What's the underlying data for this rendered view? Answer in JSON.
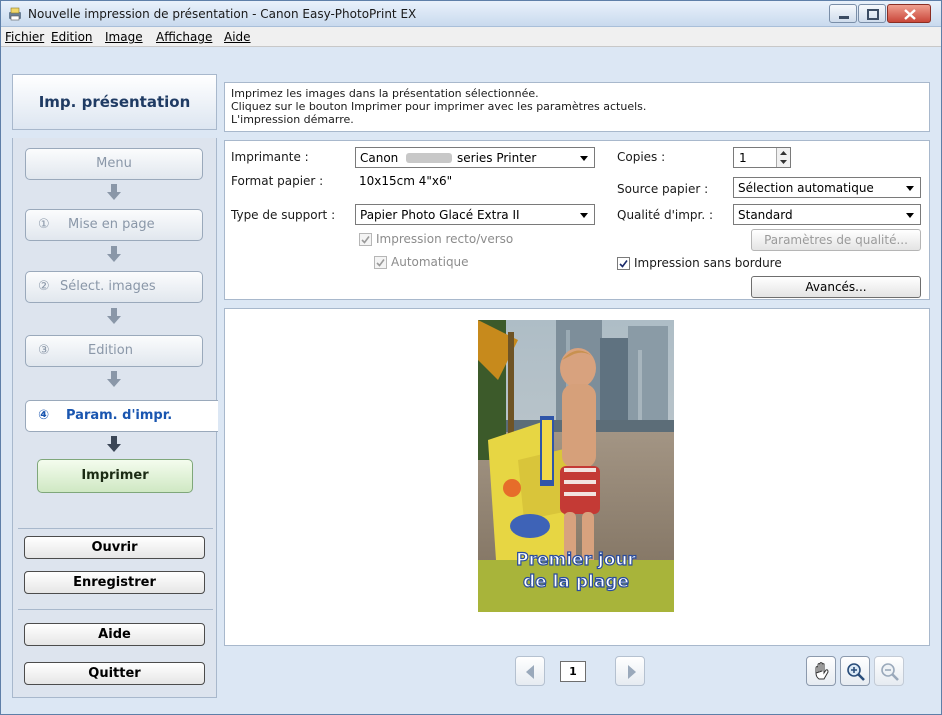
{
  "window": {
    "title": "Nouvelle impression de présentation - Canon Easy-PhotoPrint EX"
  },
  "menu": [
    "Fichier",
    "Edition",
    "Image",
    "Affichage",
    "Aide"
  ],
  "sidebar": {
    "title": "Imp. présentation",
    "steps": [
      {
        "num": "",
        "label": "Menu"
      },
      {
        "num": "①",
        "label": "Mise en page"
      },
      {
        "num": "②",
        "label": "Sélect. images"
      },
      {
        "num": "③",
        "label": "Edition"
      },
      {
        "num": "④",
        "label": "Param. d'impr."
      }
    ],
    "print_button": "Imprimer",
    "open_button": "Ouvrir",
    "save_button": "Enregistrer",
    "help_button": "Aide",
    "quit_button": "Quitter"
  },
  "info": {
    "line1": "Imprimez les images dans la présentation sélectionnée.",
    "line2": "Cliquez sur le bouton Imprimer pour imprimer avec les paramètres actuels.",
    "line3": "L'impression démarre."
  },
  "settings": {
    "printer_label": "Imprimante :",
    "printer_value_prefix": "Canon",
    "printer_value_suffix": "series Printer",
    "paper_size_label": "Format papier :",
    "paper_size_value": "10x15cm 4\"x6\"",
    "media_type_label": "Type de support :",
    "media_type_value": "Papier Photo Glacé Extra II",
    "duplex_label": "Impression recto/verso",
    "duplex_checked": true,
    "auto_label": "Automatique",
    "auto_checked": true,
    "copies_label": "Copies :",
    "copies_value": "1",
    "paper_source_label": "Source papier :",
    "paper_source_value": "Sélection automatique",
    "quality_label": "Qualité d'impr. :",
    "quality_value": "Standard",
    "quality_settings_button": "Paramètres de qualité...",
    "borderless_label": "Impression sans bordure",
    "borderless_checked": true,
    "advanced_button": "Avancés..."
  },
  "preview": {
    "caption_line1": "Premier jour",
    "caption_line2": "de la plage",
    "page_number": "1"
  },
  "colors": {
    "accent_blue": "#1a56b0",
    "print_green": "#cfe8c3",
    "panel_border": "#a8b8cc"
  }
}
